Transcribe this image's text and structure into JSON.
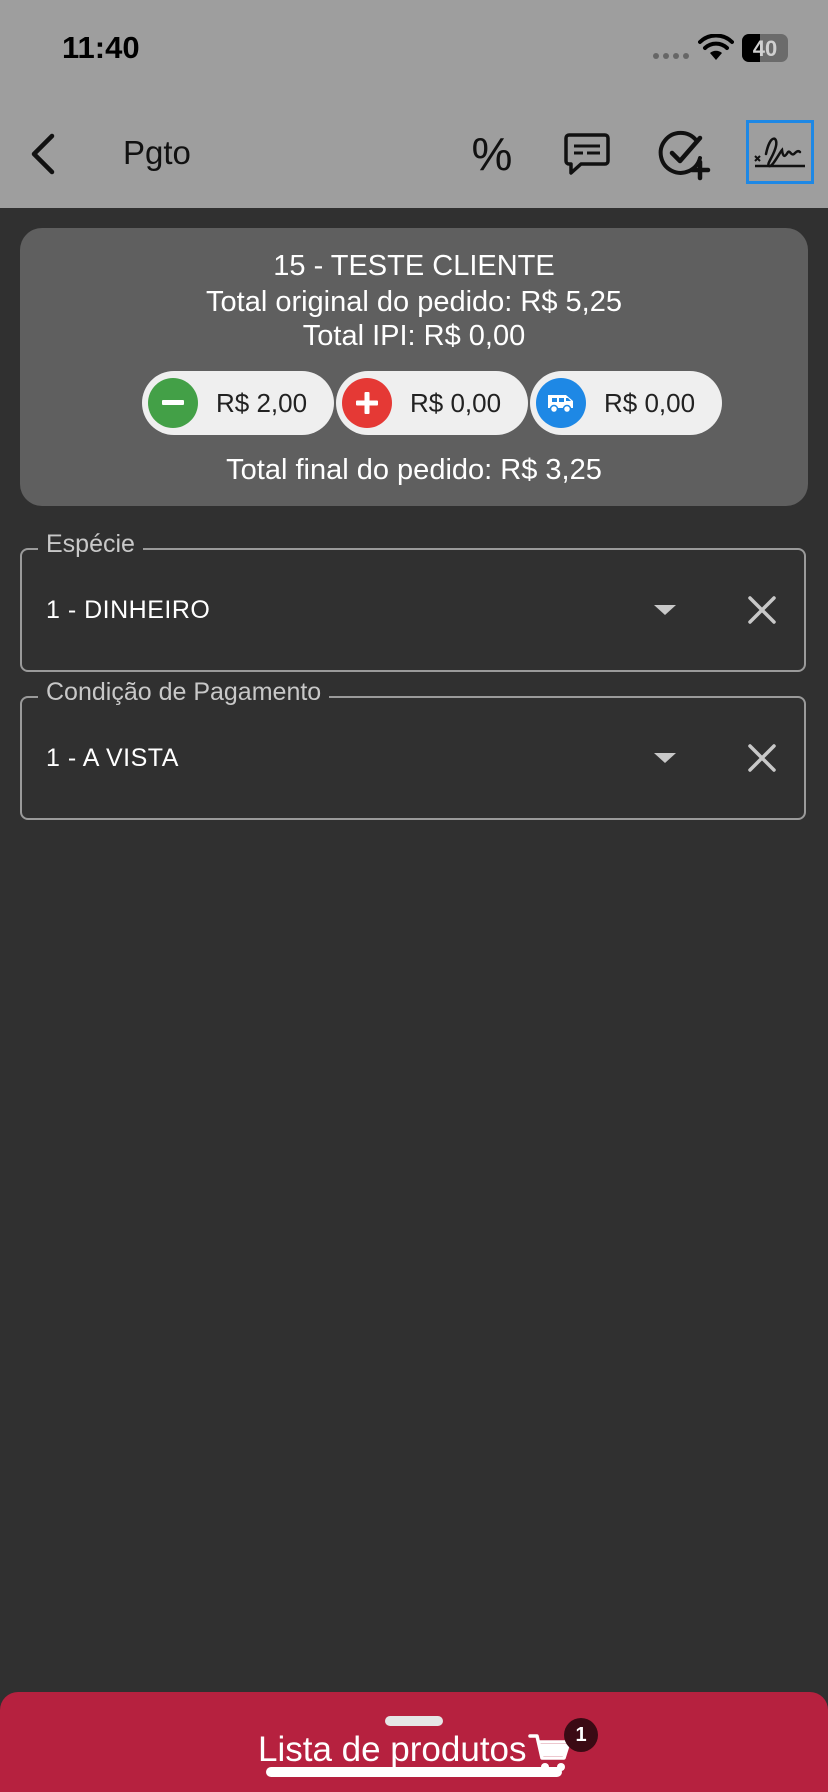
{
  "status_bar": {
    "time": "11:40",
    "battery": "40",
    "battery_level": 0.4
  },
  "app_bar": {
    "title": "Pgto",
    "actions": [
      "percent-icon",
      "message-icon",
      "check-add-icon",
      "signature-icon"
    ],
    "percent_label": "%",
    "selected_action_color": "#1e88e5"
  },
  "summary": {
    "client": "15 - TESTE CLIENTE",
    "original_total": "Total original do pedido: R$ 5,25",
    "ipi_total": "Total IPI: R$ 0,00",
    "chips": [
      {
        "icon": "minus-icon",
        "color": "#43a047",
        "value": "R$ 2,00"
      },
      {
        "icon": "plus-icon",
        "color": "#e53935",
        "value": "R$ 0,00"
      },
      {
        "icon": "truck-icon",
        "color": "#1e88e5",
        "value": "R$ 0,00"
      }
    ],
    "final_total": "Total final do pedido: R$ 3,25"
  },
  "fields": [
    {
      "label": "Espécie",
      "value": "1 - DINHEIRO"
    },
    {
      "label": "Condição de Pagamento",
      "value": "1 - A VISTA"
    }
  ],
  "bottom_bar": {
    "label": "Lista de produtos",
    "badge": "1",
    "color": "#b6213f"
  }
}
